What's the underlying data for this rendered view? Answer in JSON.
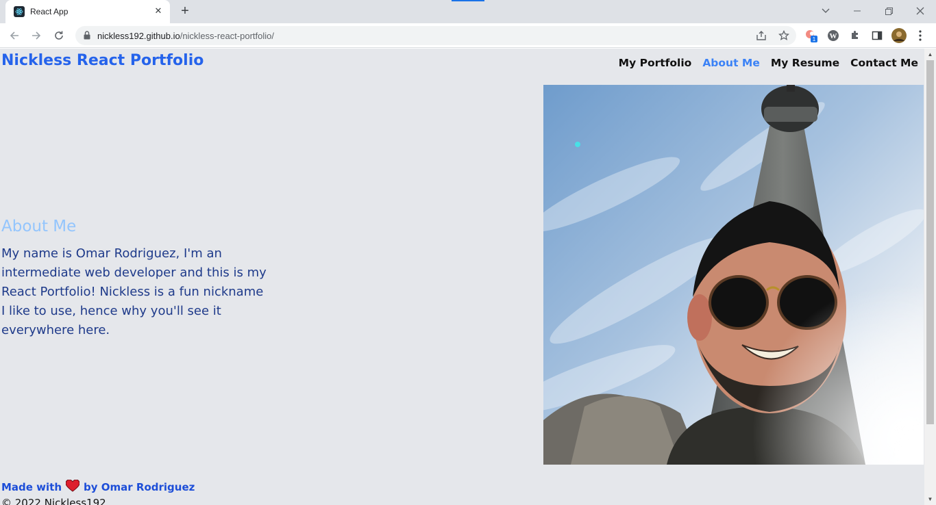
{
  "browser": {
    "tab_title": "React App",
    "url_host": "nickless192.github.io",
    "url_path": "/nickless-react-portfolio/",
    "extension_badge": "1"
  },
  "site": {
    "brand": "Nickless React Portfolio",
    "nav": [
      "My Portfolio",
      "About Me",
      "My Resume",
      "Contact Me"
    ],
    "active_nav": "About Me"
  },
  "about": {
    "heading": "About Me",
    "body": "My name is Omar Rodriguez, I'm an intermediate web developer and this is my React Portfolio! Nickless is a fun nickname I like to use, hence why you'll see it everywhere here."
  },
  "footer": {
    "made_with": "Made with",
    "by": "by Omar Rodriguez",
    "copyright": "© 2022 Nickless192"
  },
  "colors": {
    "brand": "#2563eb",
    "nav_active": "#3b82f6",
    "heading": "#93c5fd",
    "body_text": "#1e3a8a",
    "page_bg": "#e5e7eb"
  }
}
